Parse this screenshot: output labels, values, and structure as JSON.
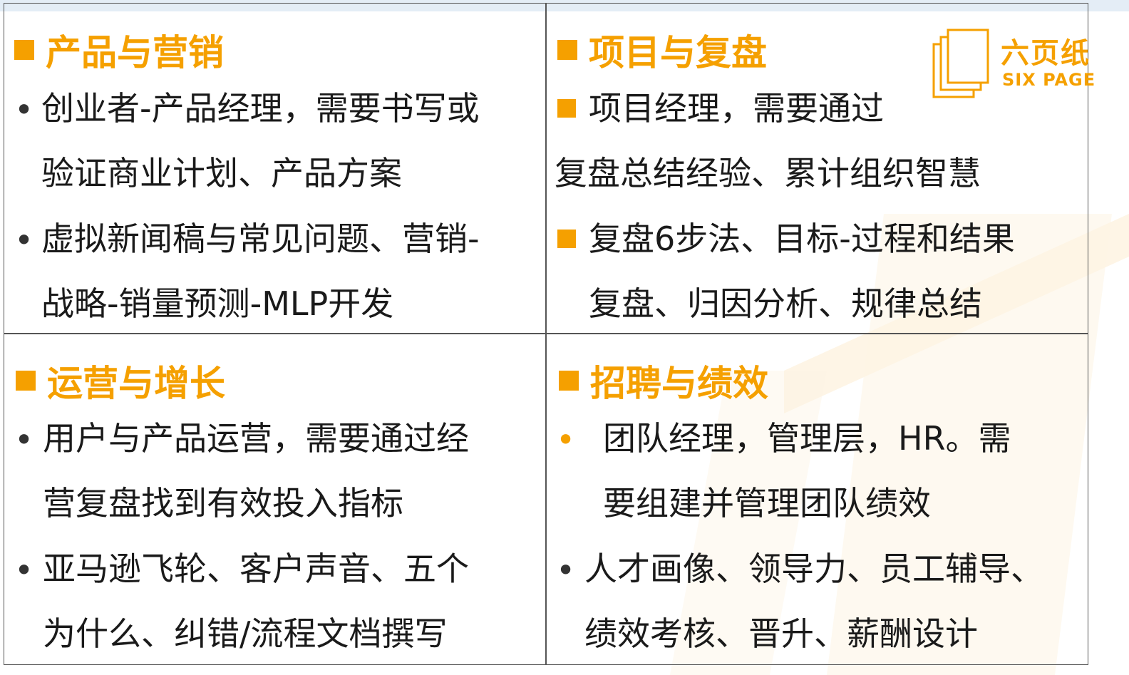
{
  "logo": {
    "cn": "六页纸",
    "en": "SIX PAGE"
  },
  "quadrants": {
    "top_left": {
      "heading": "产品与营销",
      "lines": [
        "创业者-产品经理，需要书写或",
        "验证商业计划、产品方案",
        "虚拟新闻稿与常见问题、营销-",
        "战略-销量预测-MLP开发"
      ]
    },
    "top_right": {
      "heading": "项目与复盘",
      "lines": [
        "项目经理，需要通过",
        "复盘总结经验、累计组织智慧",
        "复盘6步法、目标-过程和结果",
        "复盘、归因分析、规律总结"
      ]
    },
    "bottom_left": {
      "heading": "运营与增长",
      "lines": [
        "用户与产品运营，需要通过经",
        "营复盘找到有效投入指标",
        "亚马逊飞轮、客户声音、五个",
        "为什么、纠错/流程文档撰写"
      ]
    },
    "bottom_right": {
      "heading": "招聘与绩效",
      "lines": [
        "团队经理，管理层，HR。需",
        "要组建并管理团队绩效",
        "人才画像、领导力、员工辅导、",
        "绩效考核、晋升、薪酬设计"
      ]
    }
  },
  "bullet_glyph": "•",
  "colors": {
    "accent": "#f5a000",
    "text": "#1a1a1a",
    "border": "#555555",
    "top_strip": "#e4edf6"
  }
}
